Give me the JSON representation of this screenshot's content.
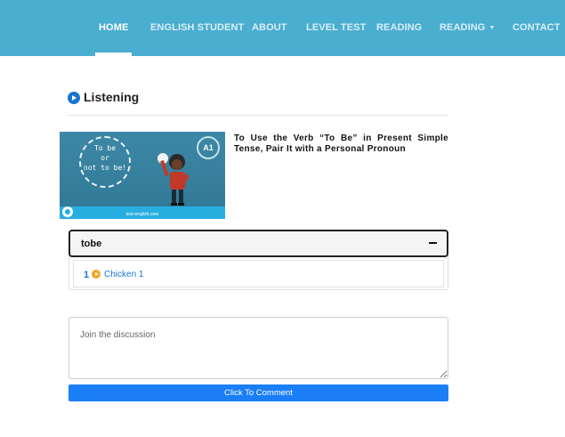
{
  "nav": {
    "items": [
      {
        "label": "HOME"
      },
      {
        "label": "ENGLISH STUDENT"
      },
      {
        "label": "ABOUT"
      },
      {
        "label": "LEVEL TEST"
      },
      {
        "label": "READING"
      },
      {
        "label": "READING"
      },
      {
        "label": "CONTACT"
      }
    ],
    "active": "HOME",
    "bg_color": "#4aaed0"
  },
  "section": {
    "title": "Listening",
    "icon": "play-circle-icon"
  },
  "lesson": {
    "title": "To Use the Verb “To Be” in Present Simple Tense, Pair It with a Personal Pronoun",
    "thumbnail": {
      "circle_text": [
        "To be",
        "or",
        "not to be!"
      ],
      "level": "A1",
      "url": "test-english.com"
    }
  },
  "accordion": {
    "title": "tobe",
    "toggle_icon": "minus-icon",
    "items": [
      {
        "number": "1",
        "icon": "play-circle-icon",
        "label": "Chicken 1"
      }
    ]
  },
  "comment": {
    "placeholder": "Join the discussion",
    "button_label": "Click To Comment",
    "button_color": "#1a7ef7"
  }
}
